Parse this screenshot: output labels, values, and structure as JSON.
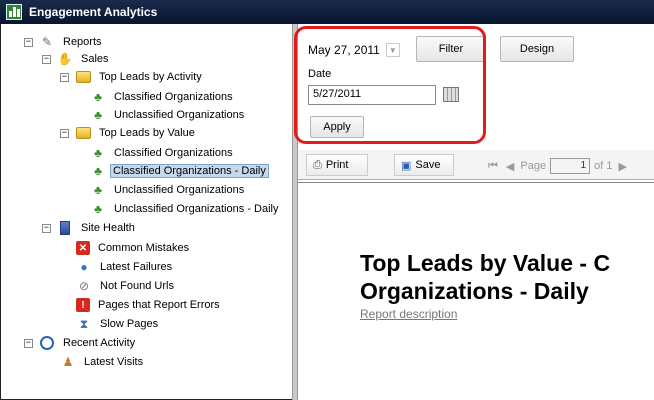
{
  "window": {
    "title": "Engagement Analytics"
  },
  "tree": {
    "root": "Reports",
    "sales": "Sales",
    "top_leads_activity": "Top Leads by Activity",
    "tla_classified": "Classified Organizations",
    "tla_unclassified": "Unclassified Organizations",
    "top_leads_value": "Top Leads by Value",
    "tlv_classified": "Classified Organizations",
    "tlv_classified_daily": "Classified Organizations - Daily",
    "tlv_unclassified": "Unclassified Organizations",
    "tlv_unclassified_daily": "Unclassified Organizations - Daily",
    "site_health": "Site Health",
    "common_mistakes": "Common Mistakes",
    "latest_failures": "Latest Failures",
    "not_found_urls": "Not Found Urls",
    "pages_report_errors": "Pages that Report Errors",
    "slow_pages": "Slow Pages",
    "recent_activity": "Recent Activity",
    "latest_visits": "Latest Visits"
  },
  "filter_panel": {
    "date_selector": "May 27, 2011",
    "filter_button": "Filter",
    "design_button": "Design",
    "date_label": "Date",
    "date_value": "5/27/2011",
    "apply_button": "Apply"
  },
  "toolbar": {
    "print": "Print",
    "save": "Save",
    "page_label": "Page",
    "page_number": "1",
    "page_of": "of 1"
  },
  "report": {
    "title_line1": "Top Leads by Value - C",
    "title_line2": "Organizations - Daily",
    "description": "Report description"
  },
  "colors": {
    "highlight": "#e01c1c",
    "titlebar": "#0a152e",
    "selection": "#c8d8ec"
  }
}
